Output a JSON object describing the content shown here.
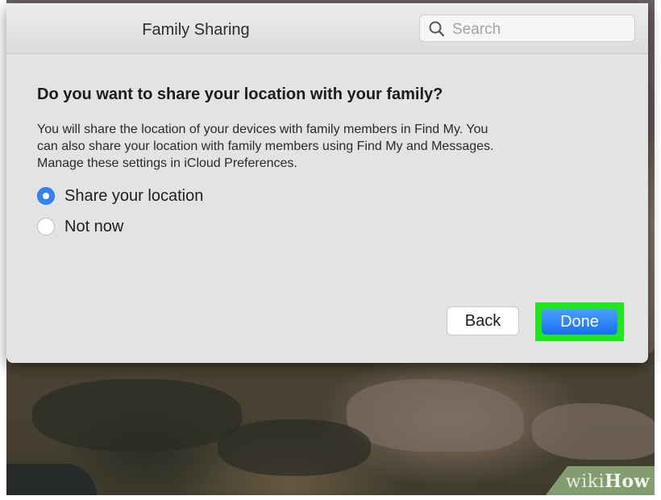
{
  "window": {
    "title": "Family Sharing",
    "search": {
      "placeholder": "Search",
      "icon": "search-icon"
    }
  },
  "dialog": {
    "question": "Do you want to share your location with your family?",
    "description_lines": [
      "You will share the location of your devices with family members in Find My. You",
      "can also share your location with family members using Find My and Messages.",
      "Manage these settings in iCloud Preferences."
    ],
    "options": [
      {
        "label": "Share your location",
        "selected": true
      },
      {
        "label": "Not now",
        "selected": false
      }
    ],
    "buttons": {
      "back": "Back",
      "done": "Done"
    }
  },
  "watermark": {
    "part1": "wiki",
    "part2": "How"
  },
  "colors": {
    "accent": "#3483f5",
    "done_button": "#1a6ff2",
    "highlight": "#1de91d",
    "window_bg": "#e3e3e3"
  }
}
